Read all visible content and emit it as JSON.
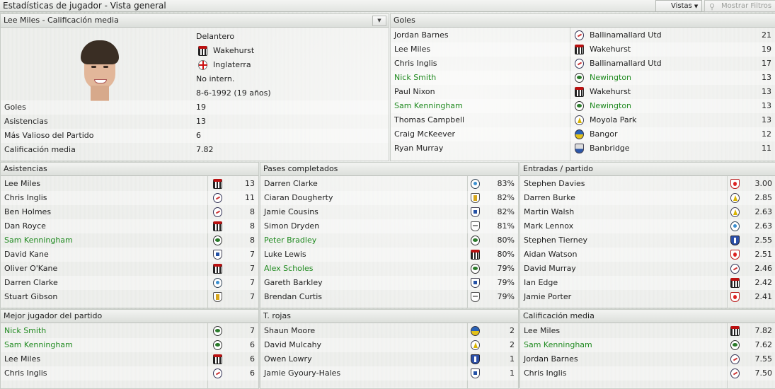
{
  "topbar": {
    "title": "Estadísticas de jugador - Vista general",
    "views_label": "Vistas",
    "filters_label": "Mostrar Filtros"
  },
  "player": {
    "header": "Lee Miles - Calificación media",
    "position": "Delantero",
    "club": "Wakehurst",
    "nation": "Inglaterra",
    "international": "No intern.",
    "dob": "8-6-1992 (19 años)",
    "stats": [
      {
        "label": "Goles",
        "value": "19"
      },
      {
        "label": "Asistencias",
        "value": "13"
      },
      {
        "label": "Más Valioso del Partido",
        "value": "6"
      },
      {
        "label": "Calificación media",
        "value": "7.82"
      }
    ]
  },
  "goals": {
    "header": "Goles",
    "rows": [
      {
        "name": "Jordan Barnes",
        "club": "Ballinamallard Utd",
        "value": "21",
        "badge": "ball",
        "highlight": false
      },
      {
        "name": "Lee Miles",
        "club": "Wakehurst",
        "value": "19",
        "badge": "wake",
        "highlight": false
      },
      {
        "name": "Chris Inglis",
        "club": "Ballinamallard Utd",
        "value": "17",
        "badge": "ball",
        "highlight": false
      },
      {
        "name": "Nick Smith",
        "club": "Newington",
        "value": "13",
        "badge": "newi",
        "highlight": true
      },
      {
        "name": "Paul Nixon",
        "club": "Wakehurst",
        "value": "13",
        "badge": "wake",
        "highlight": false
      },
      {
        "name": "Sam Kenningham",
        "club": "Newington",
        "value": "13",
        "badge": "newi",
        "highlight": true
      },
      {
        "name": "Thomas Campbell",
        "club": "Moyola Park",
        "value": "13",
        "badge": "moy",
        "highlight": false
      },
      {
        "name": "Craig McKeever",
        "club": "Bangor",
        "value": "12",
        "badge": "ban",
        "highlight": false
      },
      {
        "name": "Ryan Murray",
        "club": "Banbridge",
        "value": "11",
        "badge": "banb",
        "highlight": false
      }
    ]
  },
  "assists": {
    "header": "Asistencias",
    "rows": [
      {
        "name": "Lee Miles",
        "value": "13",
        "badge": "wake",
        "highlight": false
      },
      {
        "name": "Chris Inglis",
        "value": "11",
        "badge": "ball",
        "highlight": false
      },
      {
        "name": "Ben Holmes",
        "value": "8",
        "badge": "ball",
        "highlight": false
      },
      {
        "name": "Dan Royce",
        "value": "8",
        "badge": "wake",
        "highlight": false
      },
      {
        "name": "Sam Kenningham",
        "value": "8",
        "badge": "newi",
        "highlight": true
      },
      {
        "name": "David Kane",
        "value": "7",
        "badge": "shield",
        "highlight": false
      },
      {
        "name": "Oliver O'Kane",
        "value": "7",
        "badge": "wake",
        "highlight": false
      },
      {
        "name": "Darren Clarke",
        "value": "7",
        "badge": "crest",
        "highlight": false
      },
      {
        "name": "Stuart Gibson",
        "value": "7",
        "badge": "gold",
        "highlight": false
      }
    ]
  },
  "passes": {
    "header": "Pases completados",
    "rows": [
      {
        "name": "Darren Clarke",
        "value": "83%",
        "badge": "crest",
        "highlight": false
      },
      {
        "name": "Ciaran Dougherty",
        "value": "82%",
        "badge": "gold",
        "highlight": false
      },
      {
        "name": "Jamie Cousins",
        "value": "82%",
        "badge": "shield",
        "highlight": false
      },
      {
        "name": "Simon Dryden",
        "value": "81%",
        "badge": "wing",
        "highlight": false
      },
      {
        "name": "Peter Bradley",
        "value": "80%",
        "badge": "newi",
        "highlight": true
      },
      {
        "name": "Luke Lewis",
        "value": "80%",
        "badge": "wake",
        "highlight": false
      },
      {
        "name": "Alex Scholes",
        "value": "79%",
        "badge": "newi",
        "highlight": true
      },
      {
        "name": "Gareth Barkley",
        "value": "79%",
        "badge": "shield",
        "highlight": false
      },
      {
        "name": "Brendan Curtis",
        "value": "79%",
        "badge": "wing",
        "highlight": false
      }
    ]
  },
  "tackles": {
    "header": "Entradas / partido",
    "rows": [
      {
        "name": "Stephen Davies",
        "value": "3.00",
        "badge": "red",
        "highlight": false
      },
      {
        "name": "Darren Burke",
        "value": "2.85",
        "badge": "moy",
        "highlight": false
      },
      {
        "name": "Martin Walsh",
        "value": "2.63",
        "badge": "moy",
        "highlight": false
      },
      {
        "name": "Mark Lennox",
        "value": "2.63",
        "badge": "crest",
        "highlight": false
      },
      {
        "name": "Stephen Tierney",
        "value": "2.55",
        "badge": "blue",
        "highlight": false
      },
      {
        "name": "Aidan Watson",
        "value": "2.51",
        "badge": "red",
        "highlight": false
      },
      {
        "name": "David Murray",
        "value": "2.46",
        "badge": "ball",
        "highlight": false
      },
      {
        "name": "Ian Edge",
        "value": "2.42",
        "badge": "wake",
        "highlight": false
      },
      {
        "name": "Jamie Porter",
        "value": "2.41",
        "badge": "red",
        "highlight": false
      }
    ]
  },
  "motm": {
    "header": "Mejor jugador del partido",
    "rows": [
      {
        "name": "Nick Smith",
        "value": "7",
        "badge": "newi",
        "highlight": true
      },
      {
        "name": "Sam Kenningham",
        "value": "6",
        "badge": "newi",
        "highlight": true
      },
      {
        "name": "Lee Miles",
        "value": "6",
        "badge": "wake",
        "highlight": false
      },
      {
        "name": "Chris Inglis",
        "value": "6",
        "badge": "ball",
        "highlight": false
      }
    ]
  },
  "reds": {
    "header": "T. rojas",
    "rows": [
      {
        "name": "Shaun Moore",
        "value": "2",
        "badge": "ban",
        "highlight": false
      },
      {
        "name": "David Mulcahy",
        "value": "2",
        "badge": "moy",
        "highlight": false
      },
      {
        "name": "Owen Lowry",
        "value": "1",
        "badge": "blue",
        "highlight": false
      },
      {
        "name": "Jamie Gyoury-Hales",
        "value": "1",
        "badge": "shield",
        "highlight": false
      }
    ]
  },
  "rating": {
    "header": "Calificación media",
    "rows": [
      {
        "name": "Lee Miles",
        "value": "7.82",
        "badge": "wake",
        "highlight": false
      },
      {
        "name": "Sam Kenningham",
        "value": "7.62",
        "badge": "newi",
        "highlight": true
      },
      {
        "name": "Jordan Barnes",
        "value": "7.55",
        "badge": "ball",
        "highlight": false
      },
      {
        "name": "Chris Inglis",
        "value": "7.50",
        "badge": "ball",
        "highlight": false
      }
    ]
  }
}
